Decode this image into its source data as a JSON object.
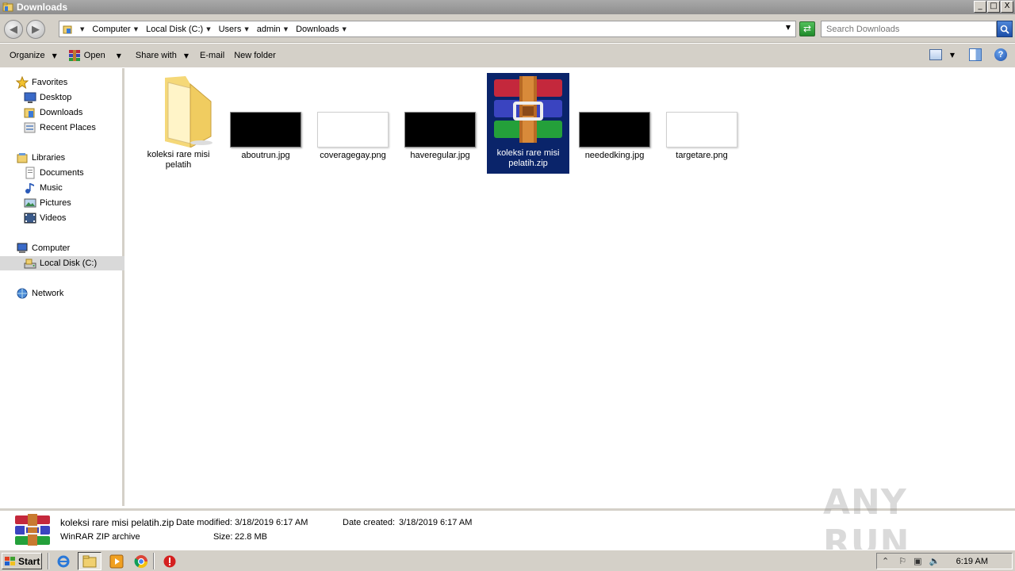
{
  "window": {
    "title": "Downloads",
    "controls": [
      "_",
      "□",
      "X"
    ]
  },
  "address": {
    "crumbs": [
      "Computer",
      "Local Disk (C:)",
      "Users",
      "admin",
      "Downloads"
    ],
    "search_placeholder": "Search Downloads"
  },
  "toolbar": {
    "organize": "Organize",
    "open": "Open",
    "share_with": "Share with",
    "email": "E-mail",
    "new_folder": "New folder"
  },
  "nav": {
    "favorites": "Favorites",
    "desktop": "Desktop",
    "downloads": "Downloads",
    "recent_places": "Recent Places",
    "libraries": "Libraries",
    "documents": "Documents",
    "music": "Music",
    "pictures": "Pictures",
    "videos": "Videos",
    "computer": "Computer",
    "local_disk": "Local Disk (C:)",
    "network": "Network"
  },
  "files": [
    {
      "name": "koleksi rare misi pelatih",
      "type": "folder"
    },
    {
      "name": "aboutrun.jpg",
      "type": "black"
    },
    {
      "name": "coveragegay.png",
      "type": "white"
    },
    {
      "name": "haveregular.jpg",
      "type": "black"
    },
    {
      "name": "koleksi rare misi pelatih.zip",
      "type": "winrar",
      "selected": true
    },
    {
      "name": "neededking.jpg",
      "type": "black"
    },
    {
      "name": "targetare.png",
      "type": "white"
    }
  ],
  "details": {
    "name": "koleksi rare misi pelatih.zip",
    "type": "WinRAR ZIP archive",
    "date_modified_label": "Date modified:",
    "date_modified": "3/18/2019 6:17 AM",
    "date_created_label": "Date created:",
    "date_created": "3/18/2019 6:17 AM",
    "size_label": "Size:",
    "size": "22.8 MB"
  },
  "taskbar": {
    "start": "Start",
    "clock": "6:19 AM"
  },
  "watermark": "ANY RUN",
  "colors": {
    "selection": "#0a246a",
    "chrome": "#d4d0c8"
  }
}
